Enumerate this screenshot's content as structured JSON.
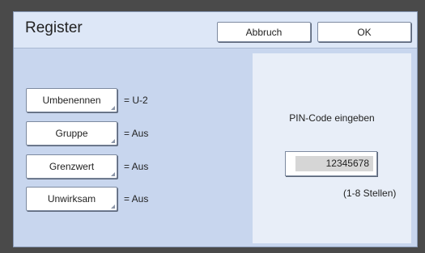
{
  "dialog": {
    "title": "Register",
    "cancel_label": "Abbruch",
    "ok_label": "OK"
  },
  "settings": [
    {
      "label": "Umbenennen",
      "value": "= U-2"
    },
    {
      "label": "Gruppe",
      "value": "= Aus"
    },
    {
      "label": "Grenzwert",
      "value": "= Aus"
    },
    {
      "label": "Unwirksam",
      "value": "= Aus"
    }
  ],
  "pin": {
    "label": "PIN-Code eingeben",
    "value": "12345678",
    "hint": "(1-8 Stellen)"
  }
}
